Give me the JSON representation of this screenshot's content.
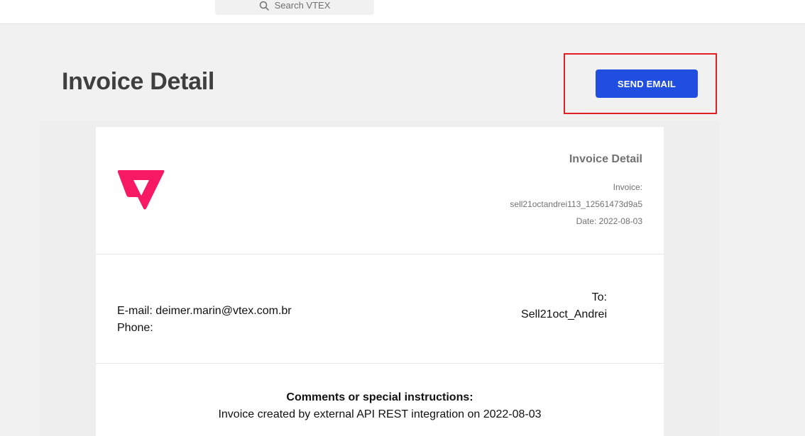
{
  "topbar": {
    "search_placeholder": "Search VTEX",
    "search_icon": "search-icon"
  },
  "page": {
    "title": "Invoice Detail",
    "send_email_label": "SEND EMAIL"
  },
  "colors": {
    "primary_button": "#1f4ee0",
    "highlight_border": "#e31e24",
    "vtex_logo": "#f71963",
    "background": "#f1f1f2"
  },
  "invoice": {
    "logo": "vtex-logo",
    "title": "Invoice Detail",
    "invoice_label": "Invoice:",
    "invoice_number": "sell21octandrei113_12561473d9a5",
    "date": "Date: 2022-08-03",
    "email": "E-mail: deimer.marin@vtex.com.br",
    "phone": "Phone:",
    "to_label": "To:",
    "to_value": "Sell21oct_Andrei",
    "comments_title": "Comments or special instructions:",
    "comments_text": "Invoice created by external API REST integration on 2022-08-03"
  }
}
